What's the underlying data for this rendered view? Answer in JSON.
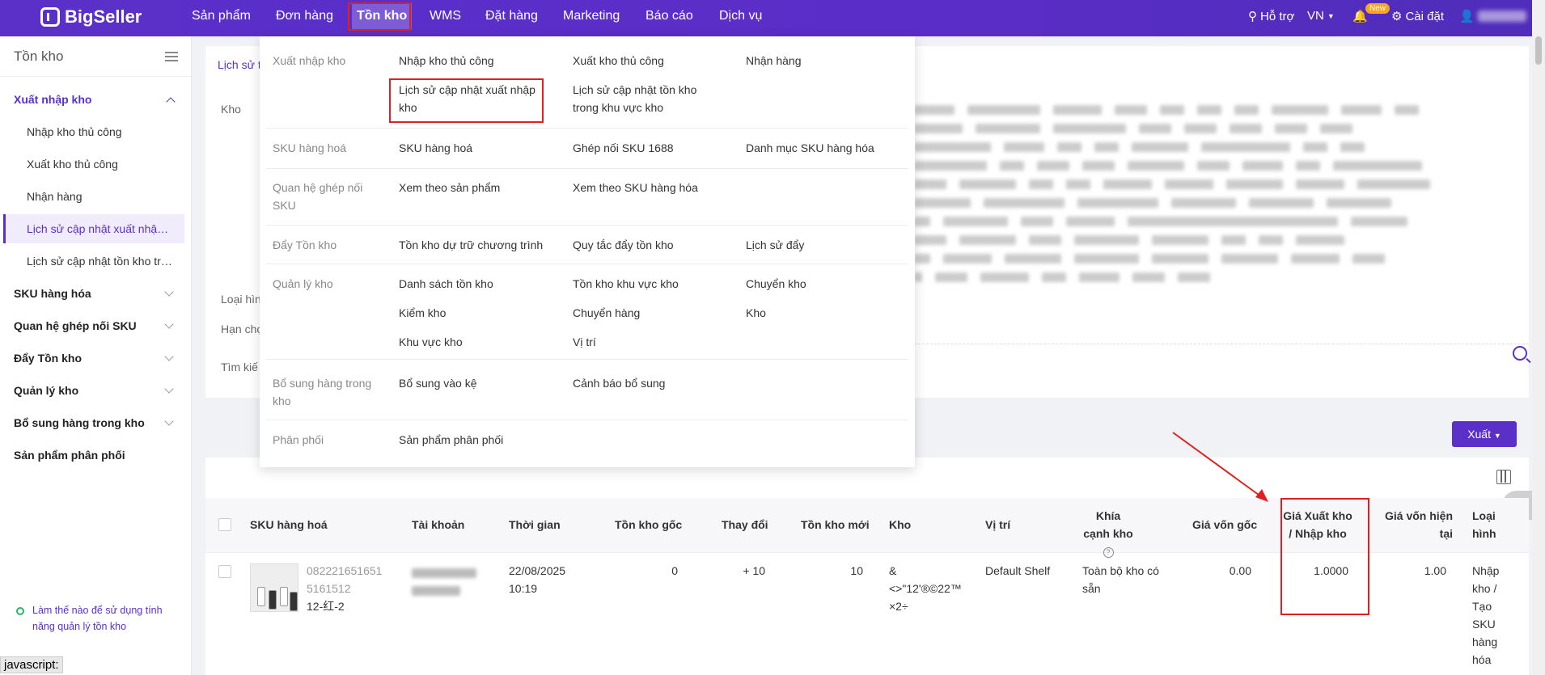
{
  "app": {
    "brand": "BigSeller"
  },
  "topnav": {
    "items": [
      "Sản phẩm",
      "Đơn hàng",
      "Tồn kho",
      "WMS",
      "Đặt hàng",
      "Marketing",
      "Báo cáo",
      "Dịch vụ"
    ],
    "active": "Tồn kho",
    "help": "Hỗ trợ",
    "lang": "VN",
    "new_badge": "New",
    "settings": "Cài đặt"
  },
  "sidebar": {
    "title": "Tồn kho",
    "groups": [
      {
        "label": "Xuất nhập kho",
        "open": true,
        "items": [
          "Nhập kho thủ công",
          "Xuất kho thủ công",
          "Nhận hàng",
          "Lịch sử cập nhật xuất nhập kho",
          "Lịch sử cập nhật tồn kho trong khu vực kho"
        ]
      },
      {
        "label": "SKU hàng hóa"
      },
      {
        "label": "Quan hệ ghép nối SKU"
      },
      {
        "label": "Đẩy Tồn kho"
      },
      {
        "label": "Quản lý kho"
      },
      {
        "label": "Bổ sung hàng trong kho"
      },
      {
        "label": "Sản phẩm phân phối"
      }
    ],
    "active_item": "Lịch sử cập nhật xuất nhập kho",
    "help_text": "Làm thế nào để sử dụng tính năng quản lý tồn kho"
  },
  "status_bar": "javascript:",
  "page": {
    "tab": "Lịch sử t",
    "filters": [
      "Kho",
      "Loại hìn",
      "Hạn chọ",
      "Tìm kiế"
    ],
    "export_label": "Xuất"
  },
  "dropdown": {
    "rows": [
      {
        "category": "Xuất nhập kho",
        "links": [
          "Nhập kho thủ công",
          "Xuất kho thủ công",
          "Nhận hàng",
          "Lịch sử cập nhật xuất nhập kho",
          "Lịch sử cập nhật tồn kho trong khu vực kho"
        ]
      },
      {
        "category": "SKU hàng hoá",
        "links": [
          "SKU hàng hoá",
          "Ghép nối SKU 1688",
          "Danh mục SKU hàng hóa"
        ]
      },
      {
        "category": "Quan hệ ghép nối SKU",
        "links": [
          "Xem theo sản phẩm",
          "Xem theo SKU hàng hóa"
        ]
      },
      {
        "category": "Đẩy Tồn kho",
        "links": [
          "Tồn kho dự trữ chương trình",
          "Quy tắc đẩy tồn kho",
          "Lịch sử đẩy"
        ]
      },
      {
        "category": "Quản lý kho",
        "links": [
          "Danh sách tồn kho",
          "Tồn kho khu vực kho",
          "Chuyển kho",
          "Kiểm kho",
          "Chuyển hàng",
          "Kho",
          "Khu vực kho",
          "Vị trí"
        ]
      },
      {
        "category": "Bổ sung hàng trong kho",
        "links": [
          "Bổ sung vào kệ",
          "Cảnh báo bổ sung"
        ]
      },
      {
        "category": "Phân phối",
        "links": [
          "Sản phẩm phân phối"
        ]
      }
    ]
  },
  "table": {
    "headers": [
      "SKU hàng hoá",
      "Tài khoản",
      "Thời gian",
      "Tồn kho gốc",
      "Thay đổi",
      "Tồn kho mới",
      "Kho",
      "Vị trí",
      "Khía cạnh kho",
      "Giá vốn gốc",
      "Giá Xuất kho / Nhập kho",
      "Giá vốn hiện tại",
      "Loại hình"
    ],
    "rows": [
      {
        "sku_code": "0822216516515161512",
        "sku_name": "12-红-2",
        "time": "22/08/2025 10:19",
        "stock_before": "0",
        "change": "+ 10",
        "stock_after": "10",
        "warehouse": "& <>\"12'®©22™ ×2÷",
        "location": "Default Shelf",
        "dimension": "Toàn bộ kho có sẵn",
        "cost_before": "0.00",
        "io_price": "1.0000",
        "cost_now": "1.00",
        "type": "Nhập kho / Tạo SKU hàng hóa"
      }
    ]
  },
  "colors": {
    "brand": "#5a30c9",
    "highlight": "#e02020"
  }
}
